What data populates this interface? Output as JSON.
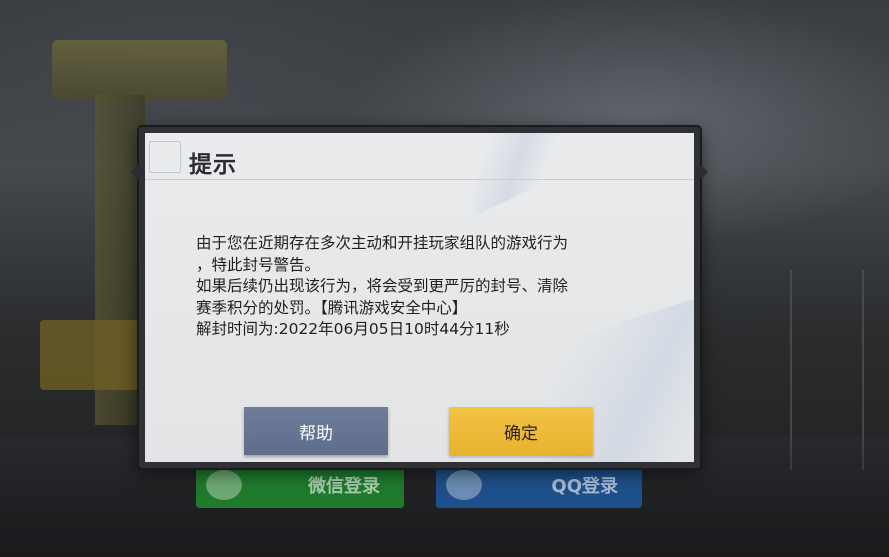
{
  "background": {
    "login_wechat_label": "微信登录",
    "login_qq_label": "QQ登录"
  },
  "dialog": {
    "title": "提示",
    "message_lines": [
      "由于您在近期存在多次主动和开挂玩家组队的游戏行为",
      "，特此封号警告。",
      "如果后续仍出现该行为，将会受到更严厉的封号、清除",
      "赛季积分的处罚。【腾讯游戏安全中心】",
      "解封时间为:2022年06月05日10时44分11秒"
    ],
    "buttons": {
      "help_label": "帮助",
      "ok_label": "确定"
    }
  },
  "colors": {
    "help_button": "#6f7d9c",
    "ok_button": "#f2c345",
    "dialog_bg": "#e7e9eb"
  }
}
